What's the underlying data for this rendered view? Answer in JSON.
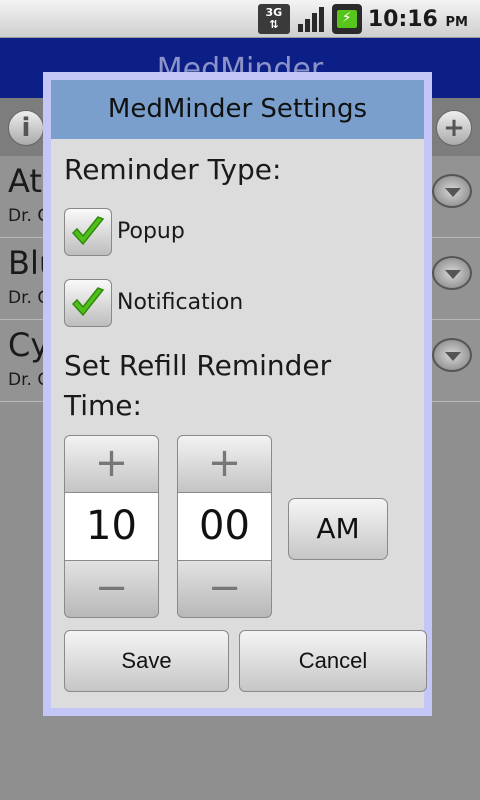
{
  "status_bar": {
    "network": "3G",
    "time": "10:16",
    "ampm": "PM"
  },
  "app": {
    "title": "MedMinder",
    "toolbar": {
      "info_icon": "info-icon",
      "add_icon": "plus-icon"
    },
    "medications": [
      {
        "name": "Ato",
        "doctor": "Dr. C"
      },
      {
        "name": "Blu",
        "doctor": "Dr. C"
      },
      {
        "name": "Cy",
        "doctor": "Dr. C"
      }
    ]
  },
  "dialog": {
    "title": "MedMinder Settings",
    "reminder_type_label": "Reminder Type:",
    "options": [
      {
        "label": "Popup",
        "checked": true
      },
      {
        "label": "Notification",
        "checked": true
      }
    ],
    "refill_label": "Set Refill Reminder Time:",
    "hour": "10",
    "minute": "00",
    "ampm": "AM",
    "plus_symbol": "+",
    "minus_symbol": "−",
    "save_label": "Save",
    "cancel_label": "Cancel",
    "colors": {
      "title_bar": "#7a9fcd",
      "border": "#c3c6f7",
      "app_header": "#0c1f86",
      "check": "#4fbf1b"
    }
  }
}
